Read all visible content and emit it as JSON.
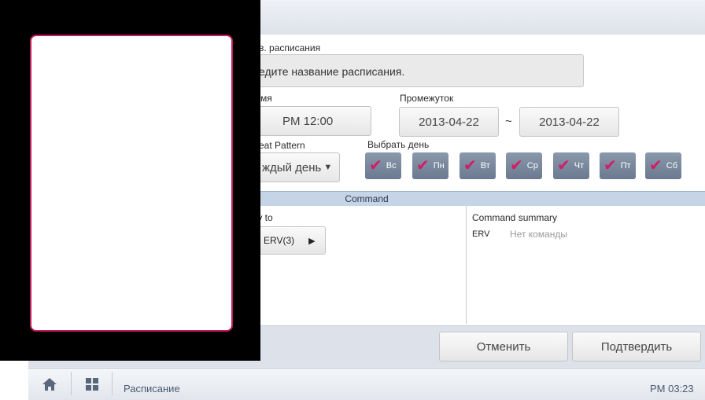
{
  "form": {
    "name_label": "в. расписания",
    "name_placeholder": "едите название расписания.",
    "time_label": "мя",
    "time_value": "PM 12:00",
    "period_label": "Промежуток",
    "period_start": "2013-04-22",
    "period_sep": "~",
    "period_end": "2013-04-22",
    "repeat_label": "eat Pattern",
    "repeat_value": "ждый день",
    "select_day_label": "Выбрать день",
    "days": [
      "Вс",
      "Пн",
      "Вт",
      "Ср",
      "Чт",
      "Пт",
      "Сб"
    ]
  },
  "command": {
    "header": "Command",
    "apply_label": "ply to",
    "apply_value": "ERV(3)",
    "summary_label": "Command summary",
    "summary_device": "ERV",
    "summary_value": "Нет команды"
  },
  "buttons": {
    "cancel": "Отменить",
    "confirm": "Подтвердить"
  },
  "statusbar": {
    "title": "Расписание",
    "time": "PM 03:23"
  },
  "colors": {
    "accent": "#d21c64",
    "day_bg": "#7a889d",
    "command_header": "#c5d4e6"
  }
}
